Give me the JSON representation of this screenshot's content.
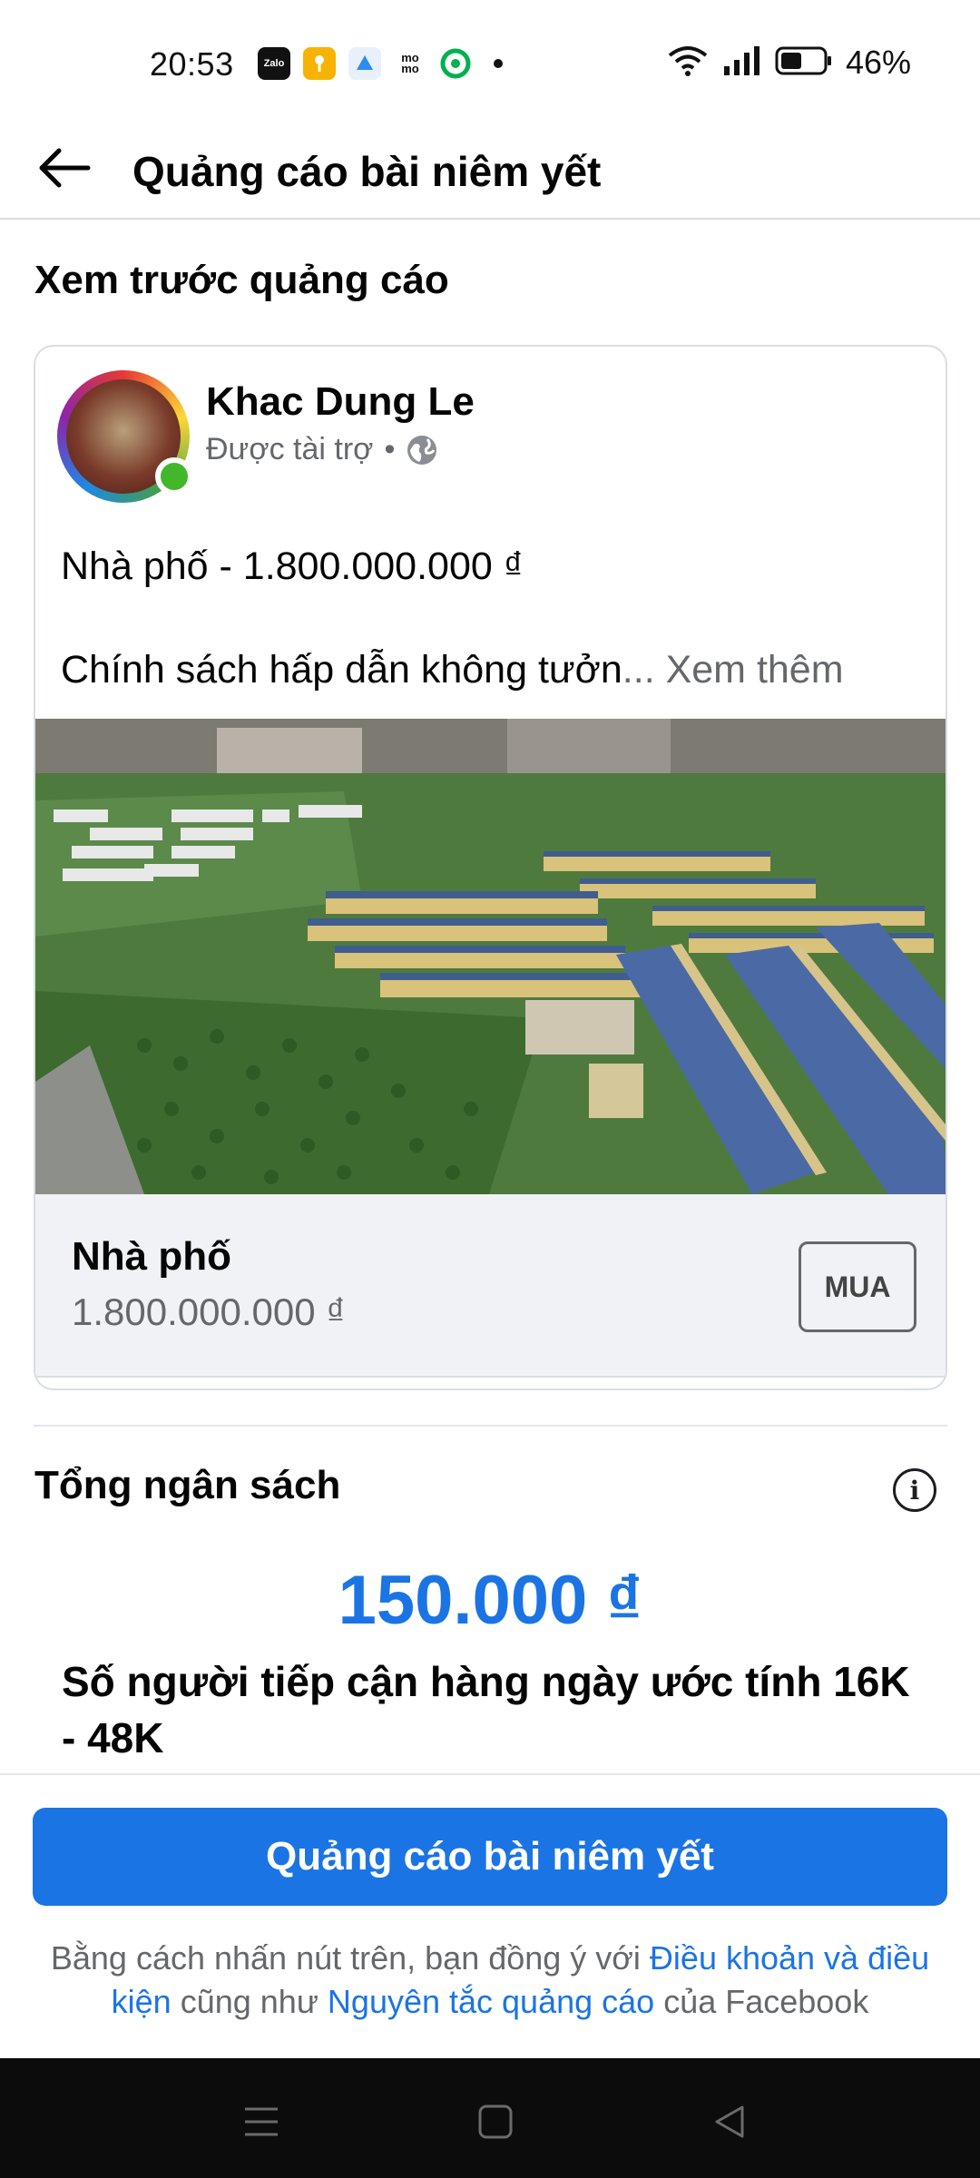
{
  "status_bar": {
    "time": "20:53",
    "notification_icons": [
      "zalo-icon",
      "key-icon",
      "app-icon",
      "momo-icon",
      "grab-icon"
    ],
    "zalo_label": "Zalo",
    "momo_label": "mo mo",
    "battery_percent": "46%"
  },
  "header": {
    "title": "Quảng cáo bài niêm yết"
  },
  "preview": {
    "section_title": "Xem trước quảng cáo",
    "page_name": "Khac Dung Le",
    "sponsored_label": "Được tài trợ",
    "separator": "•",
    "post_title": "Nhà phố - 1.800.000.000 ₫",
    "post_body": "Chính sách hấp dẫn không tưởn",
    "see_more": "... Xem thêm",
    "listing_name": "Nhà phố",
    "listing_price": "1.800.000.000 ₫",
    "buy_label": "MUA"
  },
  "budget": {
    "title": "Tổng ngân sách",
    "amount": "150.000 ₫",
    "reach_text": "Số người tiếp cận hàng ngày ước tính 16K - 48K"
  },
  "footer": {
    "cta_label": "Quảng cáo bài niêm yết",
    "terms_prefix": "Bằng cách nhấn nút trên, bạn đồng ý với ",
    "terms_link": "Điều khoản và điều kiện",
    "terms_middle": " cũng như ",
    "policy_link": "Nguyên tắc quảng cáo",
    "terms_suffix": " của Facebook"
  },
  "colors": {
    "accent": "#1b74e4",
    "online": "#42b72a",
    "secondary_text": "#65676b"
  }
}
